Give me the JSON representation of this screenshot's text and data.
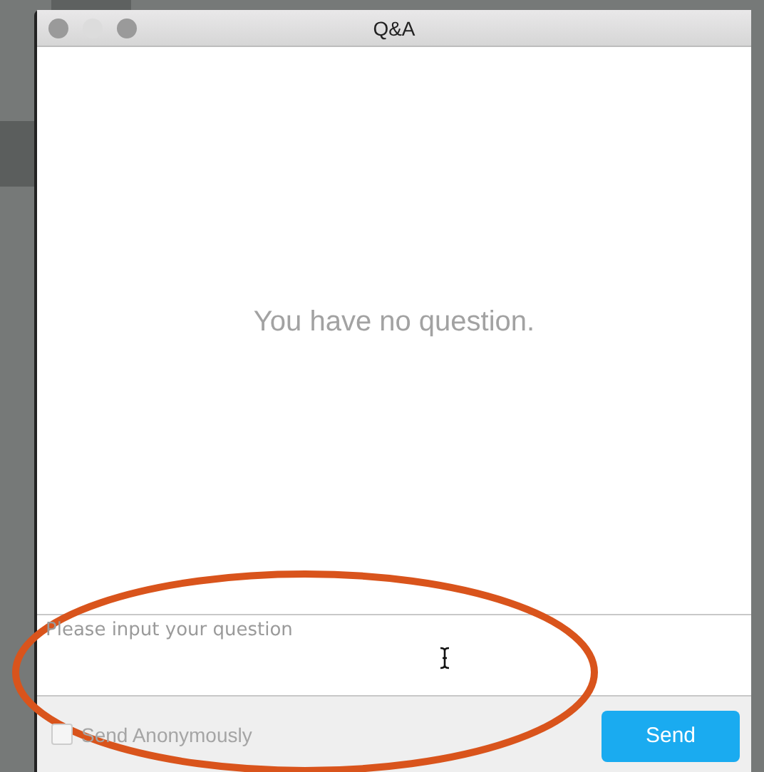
{
  "window": {
    "title": "Q&A"
  },
  "empty_message": "You have no question.",
  "question_input": {
    "placeholder": "Please input your question"
  },
  "anonymous": {
    "label": "Send Anonymously",
    "checked": false
  },
  "buttons": [
    "Send"
  ]
}
